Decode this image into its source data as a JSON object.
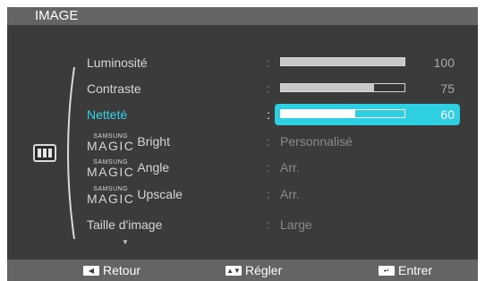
{
  "window": {
    "title": "IMAGE"
  },
  "menu": {
    "items": [
      {
        "label": "Luminosité",
        "type": "slider",
        "value": 100,
        "value_text": "100"
      },
      {
        "label": "Contraste",
        "type": "slider",
        "value": 75,
        "value_text": "75"
      },
      {
        "label": "Netteté",
        "type": "slider",
        "value": 60,
        "value_text": "60",
        "selected": true
      },
      {
        "magic_top": "SAMSUNG",
        "magic_word": "MAGIC",
        "label": "Bright",
        "type": "option",
        "value_text": "Personnalisé"
      },
      {
        "magic_top": "SAMSUNG",
        "magic_word": "MAGIC",
        "label": "Angle",
        "type": "option",
        "value_text": "Arr."
      },
      {
        "magic_top": "SAMSUNG",
        "magic_word": "MAGIC",
        "label": "Upscale",
        "type": "option",
        "value_text": "Arr."
      },
      {
        "label": "Taille d'image",
        "type": "option",
        "value_text": "Large"
      }
    ],
    "scroll_indicator": "▼",
    "separator": ":"
  },
  "footer": {
    "back_label": "Retour",
    "adjust_label": "Régler",
    "enter_label": "Entrer"
  },
  "icons": {
    "menu_category": "picture-mode-icon",
    "back": "left-arrow-key-icon",
    "adjust": "up-down-key-icon",
    "enter": "enter-key-icon"
  },
  "colors": {
    "background": "#3b3b3b",
    "title_bar": "#646464",
    "highlight": "#2dcfe0",
    "selected_text": "#34d6ea"
  }
}
